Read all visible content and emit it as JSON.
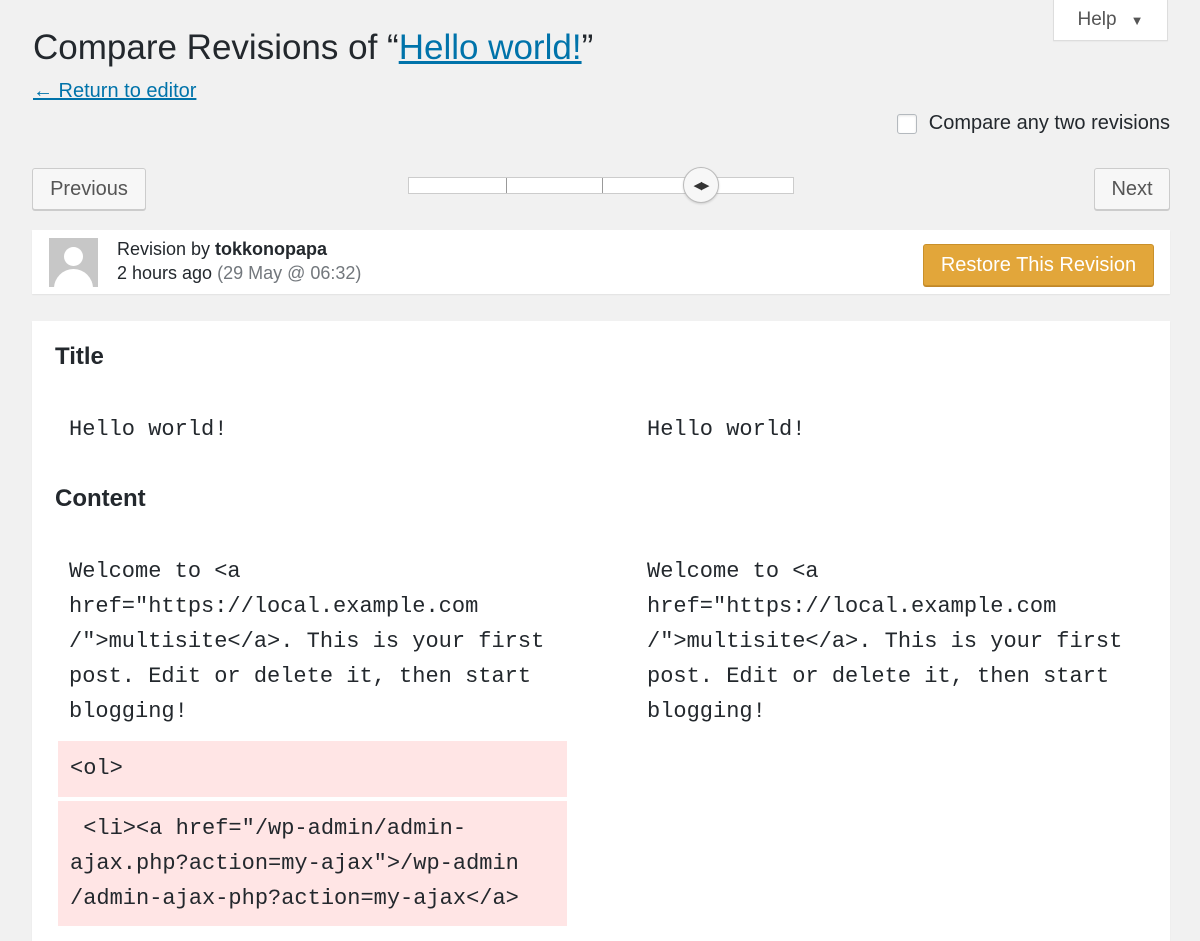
{
  "help": {
    "label": "Help",
    "caret": "▼"
  },
  "header": {
    "title_prefix": "Compare Revisions of “",
    "title_link": "Hello world!",
    "title_suffix": "”",
    "return_link": "← Return to editor"
  },
  "compare_toggle": {
    "label": "Compare any two revisions",
    "checked": false
  },
  "nav": {
    "previous_label": "Previous",
    "next_label": "Next",
    "slider_handle_glyph": "◀▶",
    "slider_position_fraction": 0.75
  },
  "revision": {
    "by_prefix": "Revision by ",
    "author": "tokkonopapa",
    "time_ago": "2 hours ago",
    "date": "(29 May @ 06:32)",
    "restore_label": "Restore This Revision"
  },
  "diff": {
    "title_heading": "Title",
    "title_left": "Hello world!",
    "title_right": "Hello world!",
    "content_heading": "Content",
    "content_left": "Welcome to <a\nhref=\"https://local.example.com\n/\">multisite</a>. This is your first\npost. Edit or delete it, then start\nblogging!",
    "content_right": "Welcome to <a\nhref=\"https://local.example.com\n/\">multisite</a>. This is your first\npost. Edit or delete it, then start\nblogging!",
    "removed_lines": [
      "<ol>",
      " <li><a href=\"/wp-admin/admin-\najax.php?action=my-ajax\">/wp-admin\n/admin-ajax-php?action=my-ajax</a>"
    ]
  },
  "colors": {
    "link": "#0073aa",
    "restore_button": "#e2a63a",
    "removed_background": "#ffe5e5"
  }
}
